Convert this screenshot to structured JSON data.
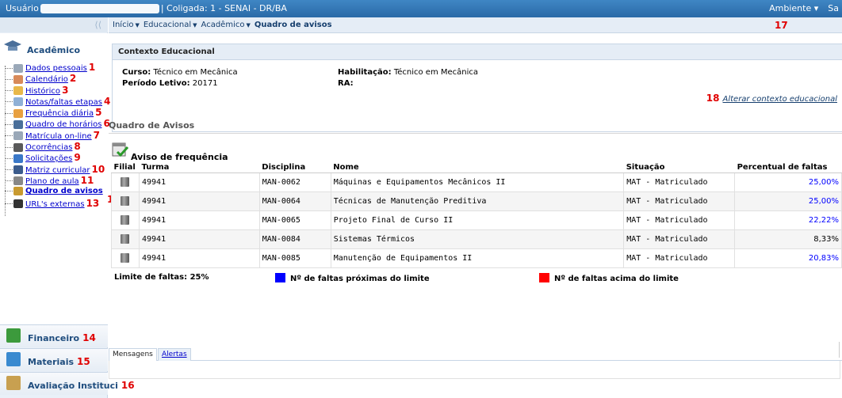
{
  "topbar": {
    "user_prefix": "Usuário",
    "coligada": "| Coligada: 1 - SENAI - DR/BA",
    "ambiente": "Ambiente ▾",
    "sair": "Sa"
  },
  "sidebar": {
    "collapse_glyph": "⟨⟨",
    "academico": "Acadêmico",
    "items": [
      {
        "label": "Dados pessoais",
        "num": "1",
        "icon_color": "#9aa8b8"
      },
      {
        "label": "Calendário",
        "num": "2",
        "icon_color": "#d88a5a"
      },
      {
        "label": "Histórico",
        "num": "3",
        "icon_color": "#e8b84a"
      },
      {
        "label": "Notas/faltas etapas",
        "num": "4",
        "icon_color": "#8fb0d6"
      },
      {
        "label": "Frequência diária",
        "num": "5",
        "icon_color": "#e8a040"
      },
      {
        "label": "Quadro de horários",
        "num": "6",
        "icon_color": "#4a6f9a"
      },
      {
        "label": "Matrícula on-line",
        "num": "7",
        "icon_color": "#9aa8b8"
      },
      {
        "label": "Ocorrências",
        "num": "8",
        "icon_color": "#5a5a5a"
      },
      {
        "label": "Solicitações",
        "num": "9",
        "icon_color": "#3a78c8"
      },
      {
        "label": "Matriz curricular",
        "num": "10",
        "icon_color": "#3c5c8c"
      },
      {
        "label": "Plano de aula",
        "num": "11",
        "icon_color": "#888888"
      },
      {
        "label": "Quadro de avisos",
        "num": "",
        "icon_color": "#c89a30"
      },
      {
        "label": "URL's externas",
        "num": "13",
        "icon_color": "#333333"
      }
    ],
    "financeiro": "Financeiro",
    "financeiro_num": "14",
    "materiais": "Materiais",
    "materiais_num": "15",
    "avaliacao": "Avaliação Instituci",
    "avaliacao_num": "16"
  },
  "breadcrumb": {
    "inicio": "Início",
    "educacional": "Educacional",
    "academico": "Acadêmico",
    "current": "Quadro de avisos",
    "num": "17"
  },
  "contexto": {
    "title": "Contexto Educacional",
    "curso_label": "Curso:",
    "curso_value": "Técnico em Mecânica",
    "periodo_label": "Período Letivo:",
    "periodo_value": "20171",
    "habilitacao_label": "Habilitação:",
    "habilitacao_value": "Técnico em Mecânica",
    "ra_label": "RA:",
    "alterar_num": "18",
    "alterar_link": "Alterar contexto educacional"
  },
  "quadro": {
    "title": "Quadro de Avisos",
    "aviso_title": "Aviso de frequência",
    "num12": "12",
    "columns": [
      "Filial",
      "Turma",
      "Disciplina",
      "Nome",
      "Situação",
      "Percentual de faltas"
    ],
    "rows": [
      {
        "turma": "49941",
        "disciplina": "MAN-0062",
        "nome": "Máquinas e Equipamentos Mecânicos II",
        "situacao": "MAT - Matriculado",
        "percentual": "25,00%",
        "pct_color": "#0000ff"
      },
      {
        "turma": "49941",
        "disciplina": "MAN-0064",
        "nome": "Técnicas de Manutenção Preditiva",
        "situacao": "MAT - Matriculado",
        "percentual": "25,00%",
        "pct_color": "#0000ff"
      },
      {
        "turma": "49941",
        "disciplina": "MAN-0065",
        "nome": "Projeto Final de Curso II",
        "situacao": "MAT - Matriculado",
        "percentual": "22,22%",
        "pct_color": "#0000ff"
      },
      {
        "turma": "49941",
        "disciplina": "MAN-0084",
        "nome": "Sistemas Térmicos",
        "situacao": "MAT - Matriculado",
        "percentual": "8,33%",
        "pct_color": "#000000"
      },
      {
        "turma": "49941",
        "disciplina": "MAN-0085",
        "nome": "Manutenção de Equipamentos II",
        "situacao": "MAT - Matriculado",
        "percentual": "20,83%",
        "pct_color": "#0000ff"
      }
    ],
    "limite": "Limite de faltas: 25%",
    "legend_blue": "Nº de faltas próximas do limite",
    "legend_red": "Nº de faltas acima do limite",
    "blue": "#0000ff",
    "red": "#ff0000"
  },
  "tabs": {
    "mensagens": "Mensagens",
    "alertas": "Alertas"
  }
}
